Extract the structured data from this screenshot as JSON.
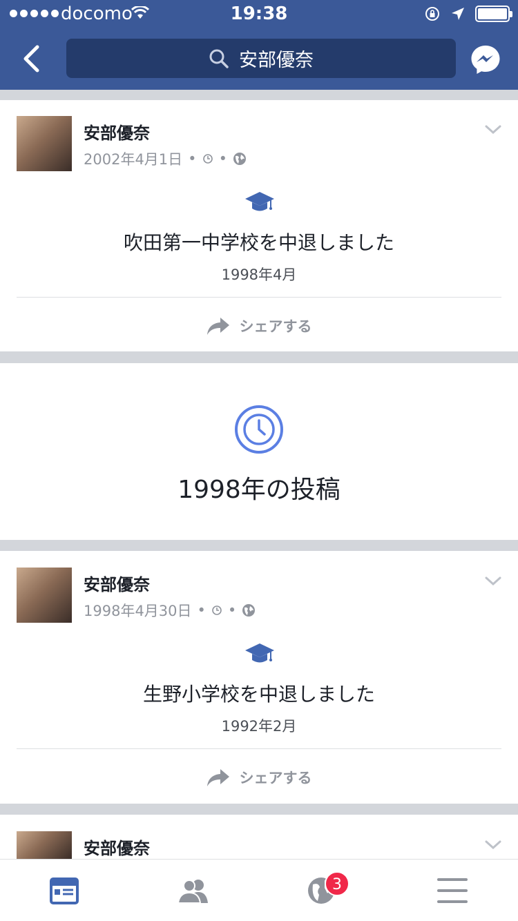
{
  "status_bar": {
    "carrier": "docomo",
    "time": "19:38"
  },
  "nav": {
    "search_text": "安部優奈"
  },
  "posts": [
    {
      "author": "安部優奈",
      "date": "2002年4月1日",
      "life_event": "吹田第一中学校を中退しました",
      "event_date": "1998年4月",
      "share_label": "シェアする"
    },
    {
      "author": "安部優奈",
      "date": "1998年4月30日",
      "life_event": "生野小学校を中退しました",
      "event_date": "1992年2月",
      "share_label": "シェアする"
    },
    {
      "author": "安部優奈"
    }
  ],
  "year_section": {
    "title": "1998年の投稿"
  },
  "tabbar": {
    "notifications_badge": "3"
  },
  "colors": {
    "brand": "#3b5998",
    "accent": "#5b7fe3",
    "badge": "#f02849"
  }
}
